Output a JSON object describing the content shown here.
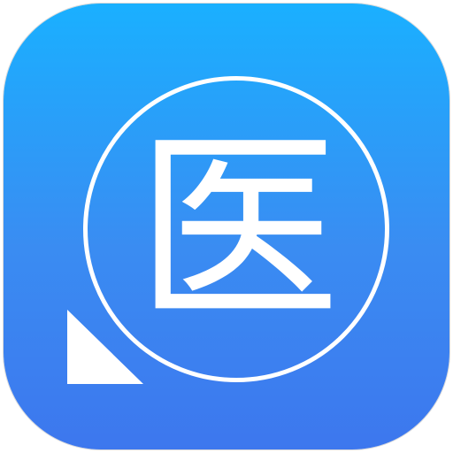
{
  "app_icon": {
    "glyph": "医",
    "icon_name": "medical-search-icon",
    "colors": {
      "gradient_top": "#1ab0ff",
      "gradient_bottom": "#3d77ee",
      "foreground": "#ffffff"
    }
  }
}
